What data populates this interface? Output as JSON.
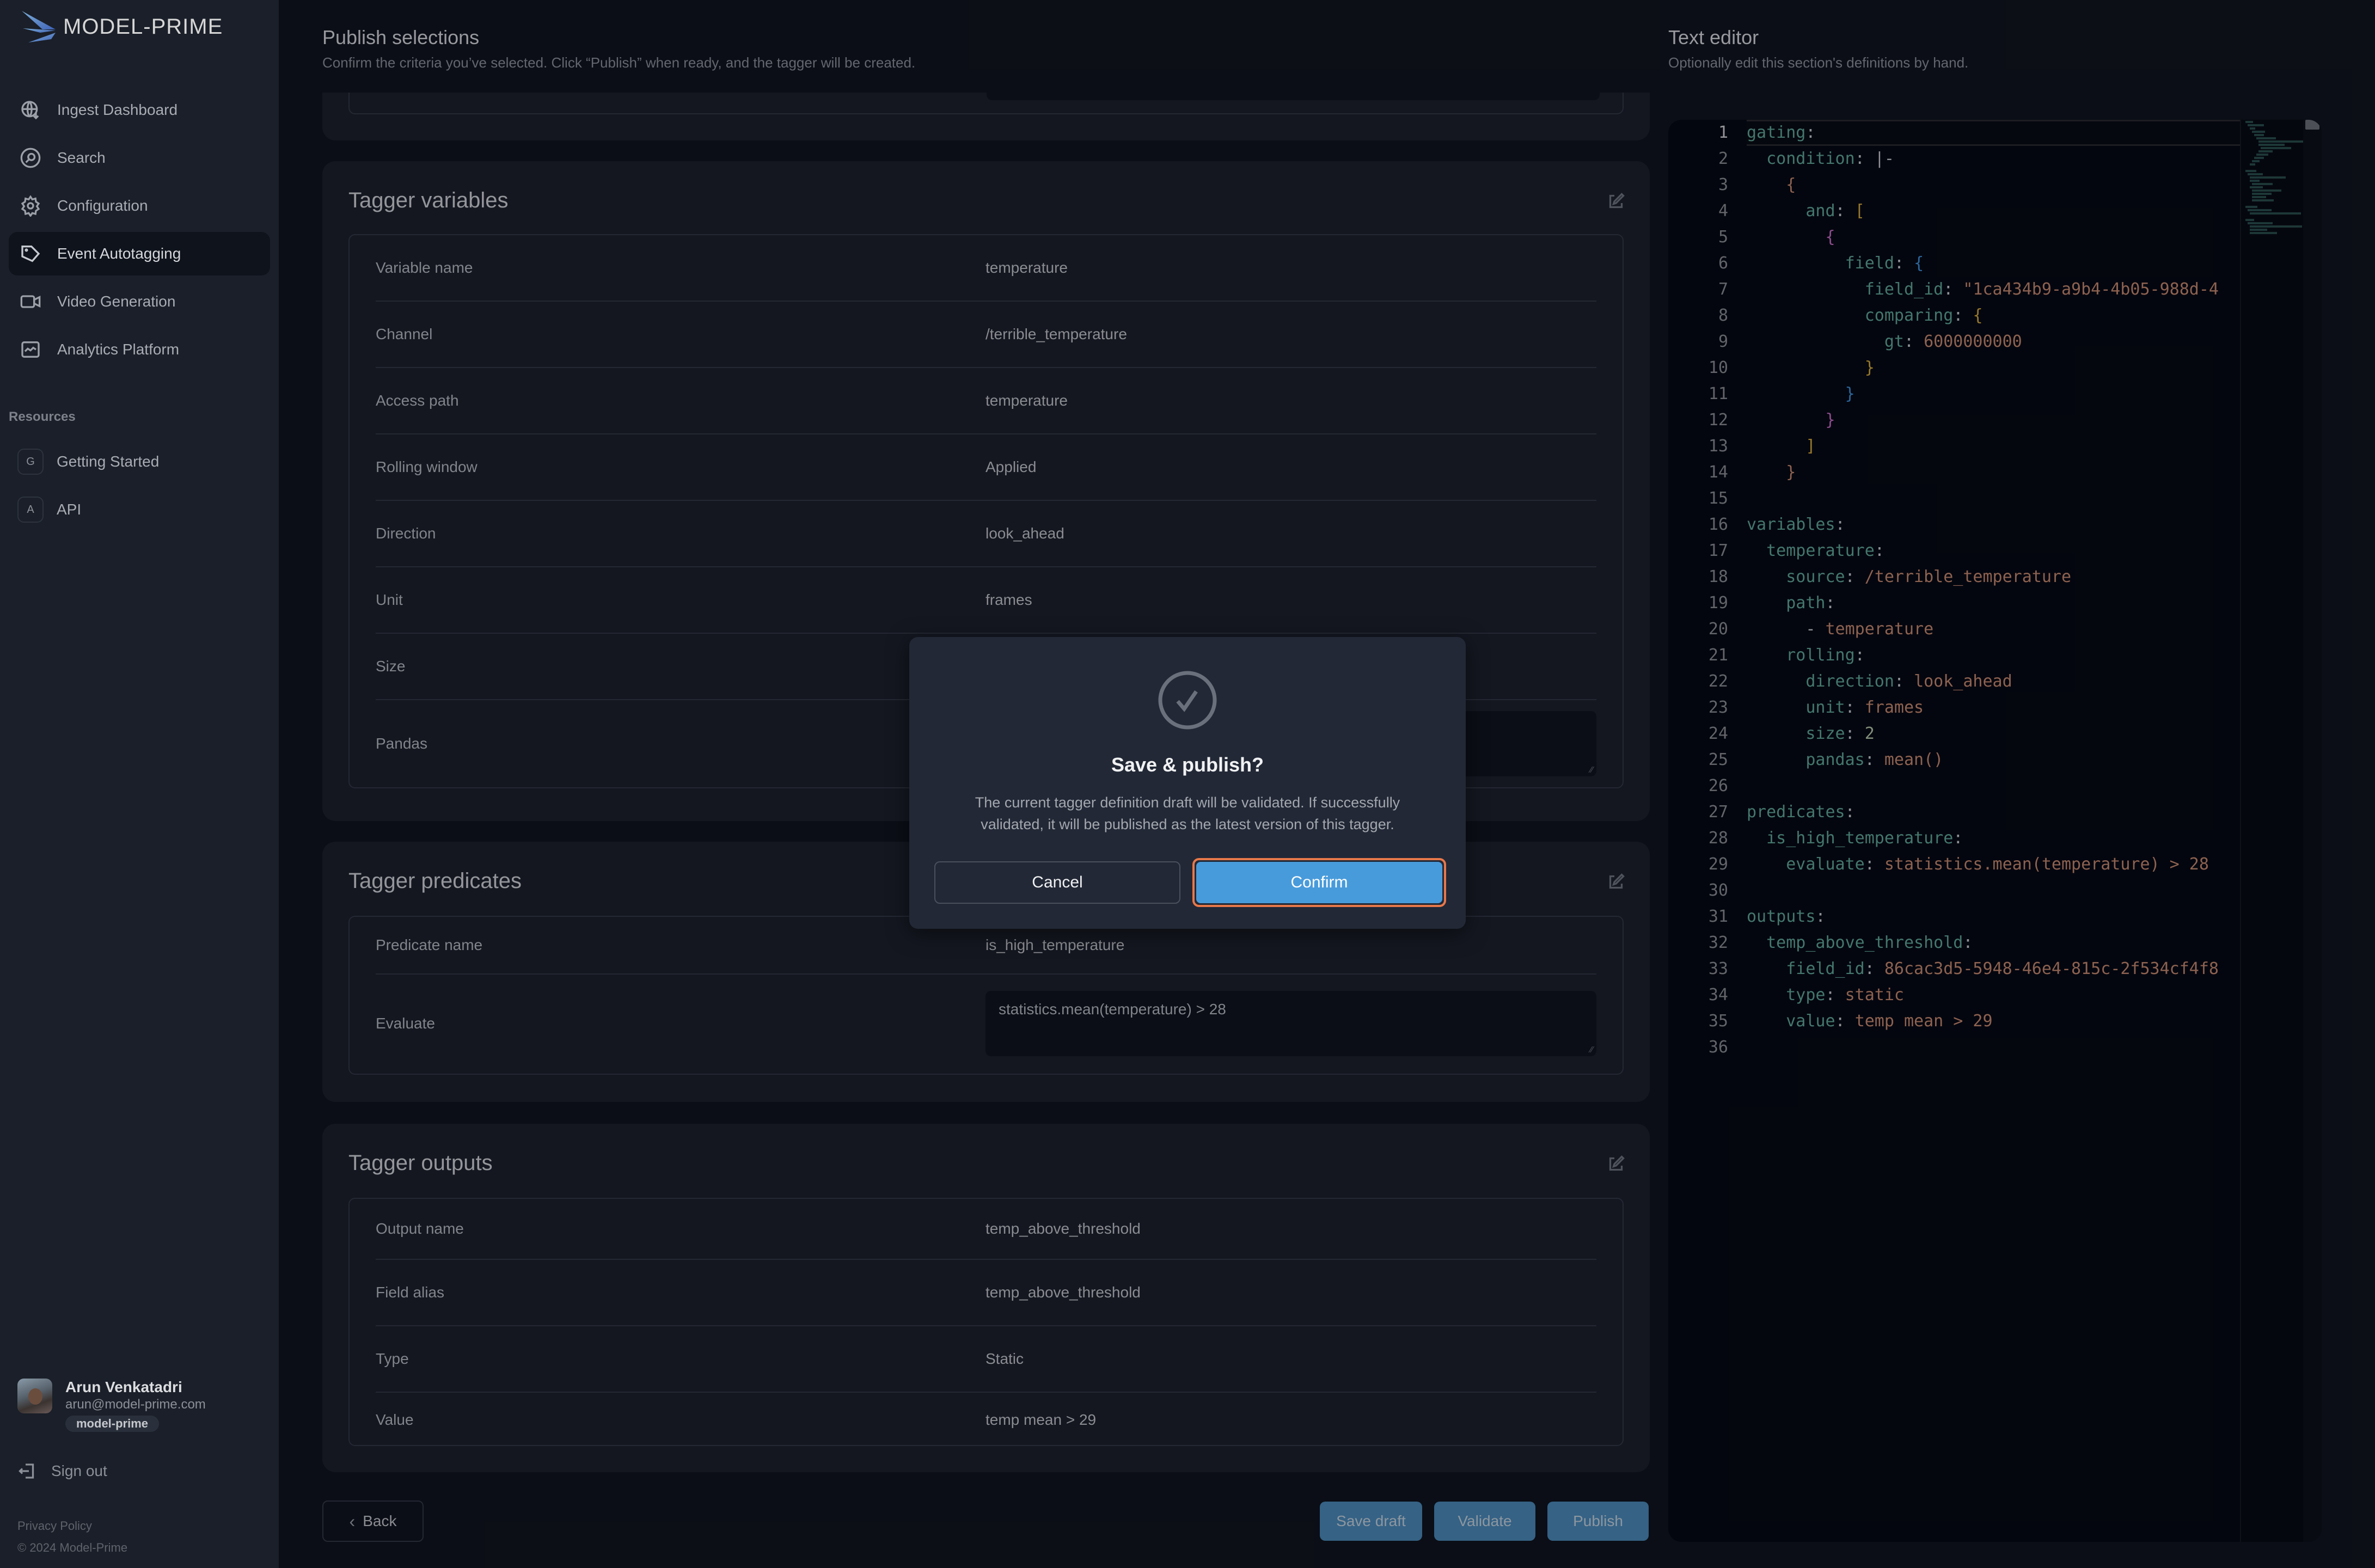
{
  "app": {
    "brand": "MODEL-PRIME"
  },
  "sidebar": {
    "items": [
      {
        "label": "Ingest Dashboard",
        "icon": "globe-download-icon",
        "active": false
      },
      {
        "label": "Search",
        "icon": "search-icon",
        "active": false
      },
      {
        "label": "Configuration",
        "icon": "gear-icon",
        "active": false
      },
      {
        "label": "Event Autotagging",
        "icon": "tag-icon",
        "active": true
      },
      {
        "label": "Video Generation",
        "icon": "video-camera-icon",
        "active": false
      },
      {
        "label": "Analytics Platform",
        "icon": "chart-icon",
        "active": false
      }
    ],
    "resources_label": "Resources",
    "resources": [
      {
        "badge": "G",
        "label": "Getting Started"
      },
      {
        "badge": "A",
        "label": "API"
      }
    ],
    "user": {
      "name": "Arun Venkatadri",
      "email": "arun@model-prime.com",
      "org": "model-prime"
    },
    "sign_out": "Sign out",
    "privacy": "Privacy Policy",
    "copyright": "© 2024 Model-Prime"
  },
  "main": {
    "title": "Publish selections",
    "subtitle": "Confirm the criteria you’ve selected. Click “Publish” when ready, and the tagger will be created.",
    "variables": {
      "title": "Tagger variables",
      "rows": [
        {
          "key": "Variable name",
          "value": "temperature"
        },
        {
          "key": "Channel",
          "value": "/terrible_temperature"
        },
        {
          "key": "Access path",
          "value": "temperature"
        },
        {
          "key": "Rolling window",
          "value": "Applied"
        },
        {
          "key": "Direction",
          "value": "look_ahead"
        },
        {
          "key": "Unit",
          "value": "frames"
        },
        {
          "key": "Size",
          "value": ""
        },
        {
          "key": "Pandas",
          "value": ""
        }
      ]
    },
    "predicates": {
      "title": "Tagger predicates",
      "rows": [
        {
          "key": "Predicate name",
          "value": "is_high_temperature"
        },
        {
          "key": "Evaluate",
          "value": "statistics.mean(temperature) > 28"
        }
      ]
    },
    "outputs": {
      "title": "Tagger outputs",
      "rows": [
        {
          "key": "Output name",
          "value": "temp_above_threshold"
        },
        {
          "key": "Field alias",
          "value": "temp_above_threshold"
        },
        {
          "key": "Type",
          "value": "Static"
        },
        {
          "key": "Value",
          "value": "temp mean > 29"
        }
      ]
    },
    "footer": {
      "back": "Back",
      "save_draft": "Save draft",
      "validate": "Validate",
      "publish": "Publish"
    }
  },
  "dialog": {
    "title": "Save & publish?",
    "body": "The current tagger definition draft will be validated. If successfully validated, it will be published as the latest version of this tagger.",
    "cancel": "Cancel",
    "confirm": "Confirm"
  },
  "editor": {
    "title": "Text editor",
    "subtitle": "Optionally edit this section's definitions by hand.",
    "lines": [
      "gating:",
      "  condition: |-",
      "    {",
      "      and: [",
      "        {",
      "          field: {",
      "            field_id: \"1ca434b9-a9b4-4b05-988d-4",
      "            comparing: {",
      "              gt: 6000000000",
      "            }",
      "          }",
      "        }",
      "      ]",
      "    }",
      "",
      "variables:",
      "  temperature:",
      "    source: /terrible_temperature",
      "    path:",
      "      - temperature",
      "    rolling:",
      "      direction: look_ahead",
      "      unit: frames",
      "      size: 2",
      "      pandas: mean()",
      "",
      "predicates:",
      "  is_high_temperature:",
      "    evaluate: statistics.mean(temperature) > 28",
      "",
      "outputs:",
      "  temp_above_threshold:",
      "    field_id: 86cac3d5-5948-46e4-815c-2f534cf4f8",
      "    type: static",
      "    value: temp mean > 29",
      ""
    ]
  }
}
